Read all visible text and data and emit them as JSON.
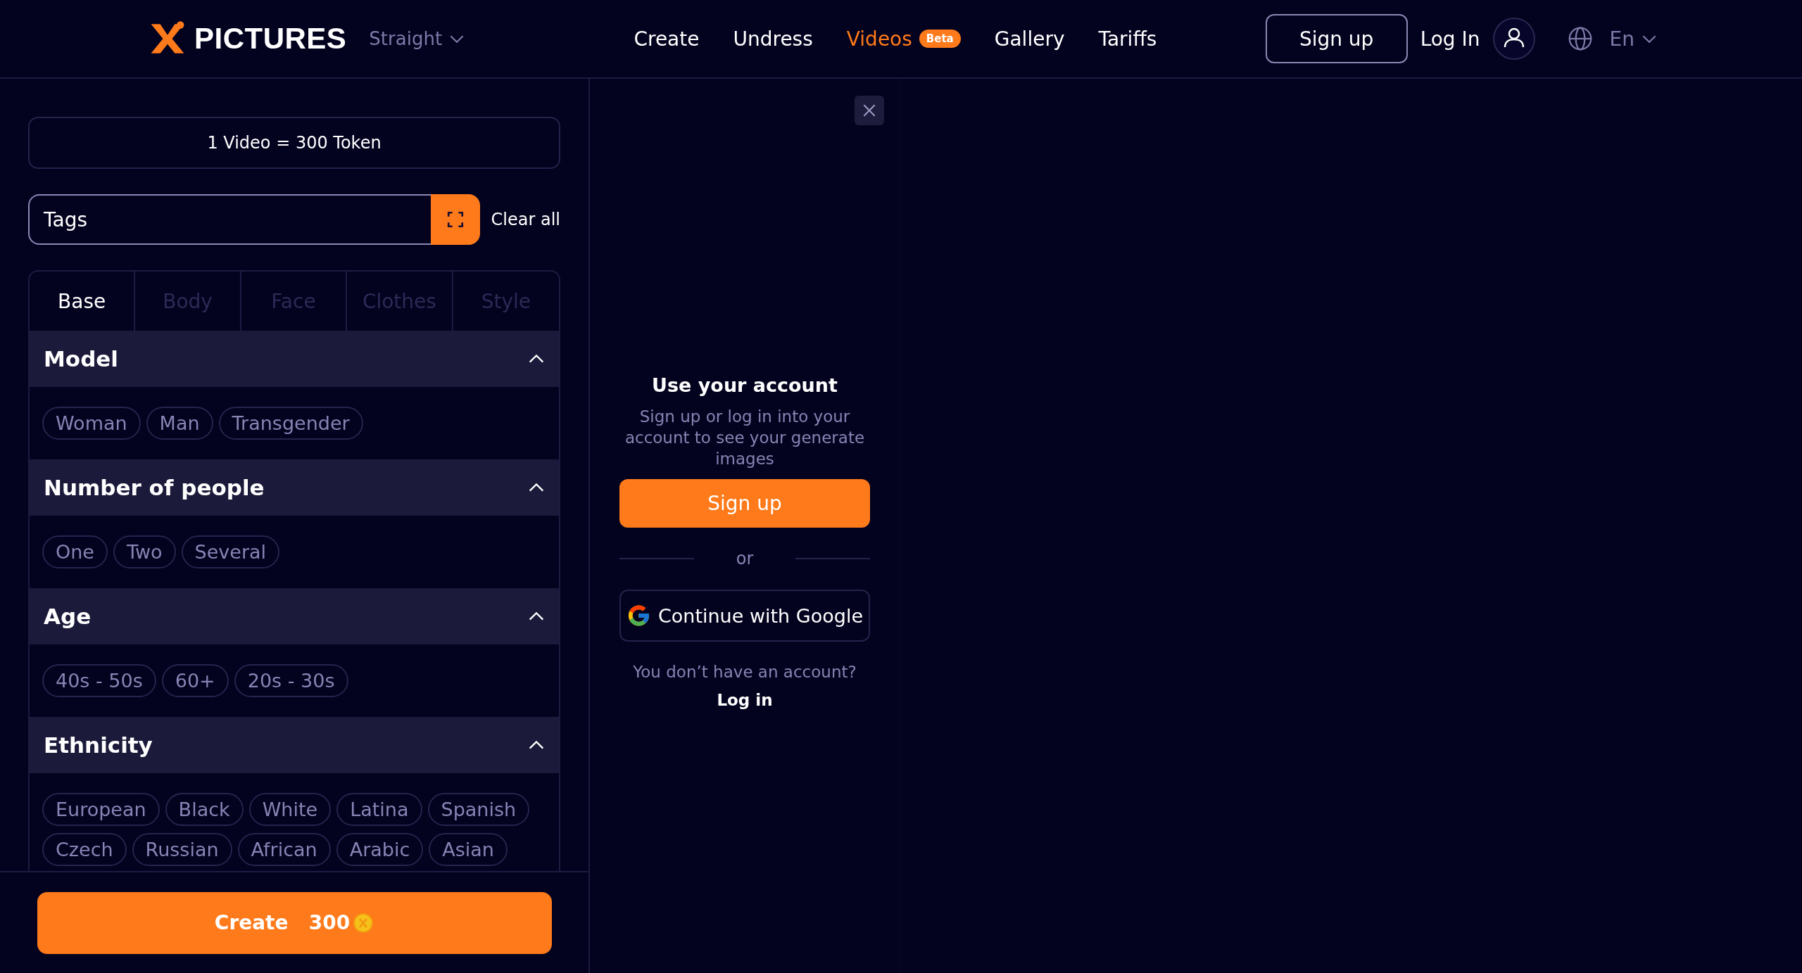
{
  "header": {
    "logo_text": "PICTURES",
    "mode": "Straight",
    "nav": [
      {
        "label": "Create",
        "selected": false
      },
      {
        "label": "Undress",
        "selected": false
      },
      {
        "label": "Videos",
        "selected": true,
        "badge": "Beta"
      },
      {
        "label": "Gallery",
        "selected": false
      },
      {
        "label": "Tariffs",
        "selected": false
      }
    ],
    "signup": "Sign up",
    "login": "Log In",
    "language": "En"
  },
  "sidebar": {
    "price": "1 Video = 300 Token",
    "tags_placeholder": "Tags",
    "clear": "Clear all",
    "tabs": [
      {
        "label": "Base",
        "selected": true
      },
      {
        "label": "Body",
        "selected": false
      },
      {
        "label": "Face",
        "selected": false
      },
      {
        "label": "Clothes",
        "selected": false
      },
      {
        "label": "Style",
        "selected": false
      }
    ],
    "sections": [
      {
        "title": "Model",
        "expanded": true,
        "chips": [
          "Woman",
          "Man",
          "Transgender"
        ]
      },
      {
        "title": "Number of people",
        "expanded": true,
        "chips": [
          "One",
          "Two",
          "Several"
        ]
      },
      {
        "title": "Age",
        "expanded": true,
        "chips": [
          "40s - 50s",
          "60+",
          "20s - 30s"
        ]
      },
      {
        "title": "Ethnicity",
        "expanded": true,
        "chips": [
          "European",
          "Black",
          "White",
          "Latina",
          "Spanish",
          "Czech",
          "Russian",
          "African",
          "Arabic",
          "Asian"
        ]
      }
    ],
    "create_label": "Create",
    "create_cost": "300"
  },
  "account_panel": {
    "title": "Use your account",
    "text": "Sign up or log in into your account to see your generate images",
    "signup": "Sign up",
    "or": "or",
    "google": "Continue with Google",
    "question": "You don’t have an account?",
    "login": "Log in"
  }
}
